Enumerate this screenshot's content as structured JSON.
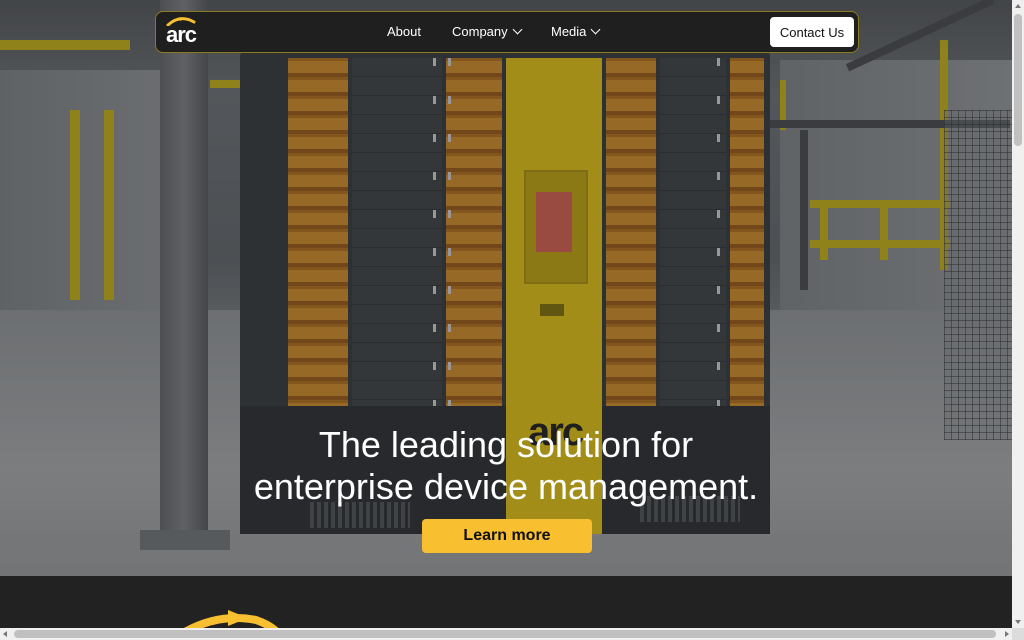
{
  "brand": {
    "logo_text": "arc",
    "accent_color": "#f8bf31",
    "nav_bg": "#1f1f1f"
  },
  "nav": {
    "items": [
      {
        "label": "About",
        "has_dropdown": false
      },
      {
        "label": "Company",
        "has_dropdown": true
      },
      {
        "label": "Media",
        "has_dropdown": true
      }
    ],
    "contact_label": "Contact Us"
  },
  "hero": {
    "headline_line1": "The leading solution for",
    "headline_line2": "enterprise device management.",
    "cta_label": "Learn more",
    "kiosk_logo": "arc"
  },
  "icons": {
    "logo": "arc-swoosh-icon",
    "dropdown": "chevron-down-icon",
    "section_mark": "arc-swoosh-icon"
  }
}
